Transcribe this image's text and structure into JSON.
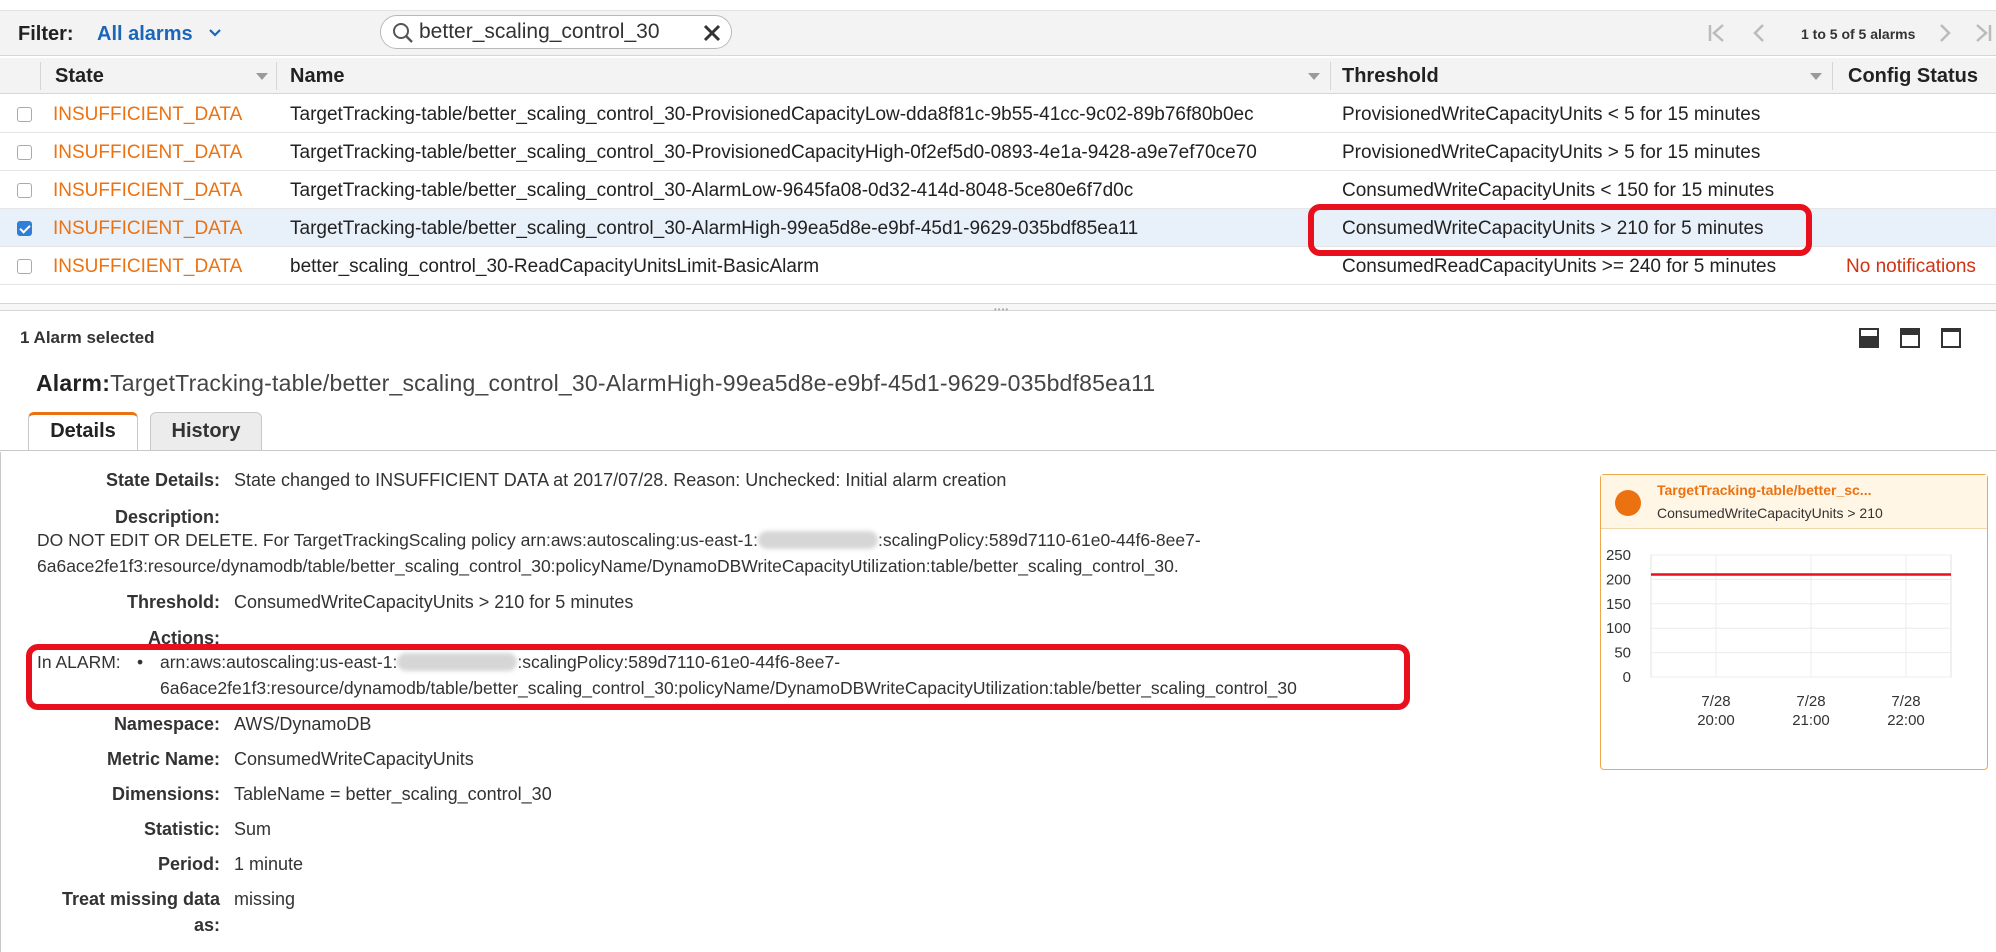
{
  "filter": {
    "label": "Filter:",
    "selected": "All alarms",
    "search_value": "better_scaling_control_30",
    "pager_text": "1 to 5 of 5 alarms"
  },
  "table": {
    "columns": [
      "State",
      "Name",
      "Threshold",
      "Config Status"
    ],
    "rows": [
      {
        "checked": false,
        "state": "INSUFFICIENT_DATA",
        "name": "TargetTracking-table/better_scaling_control_30-ProvisionedCapacityLow-dda8f81c-9b55-41cc-9c02-89b76f80b0ec",
        "threshold": "ProvisionedWriteCapacityUnits < 5 for 15 minutes",
        "config": ""
      },
      {
        "checked": false,
        "state": "INSUFFICIENT_DATA",
        "name": "TargetTracking-table/better_scaling_control_30-ProvisionedCapacityHigh-0f2ef5d0-0893-4e1a-9428-a9e7ef70ce70",
        "threshold": "ProvisionedWriteCapacityUnits > 5 for 15 minutes",
        "config": ""
      },
      {
        "checked": false,
        "state": "INSUFFICIENT_DATA",
        "name": "TargetTracking-table/better_scaling_control_30-AlarmLow-9645fa08-0d32-414d-8048-5ce80e6f7d0c",
        "threshold": "ConsumedWriteCapacityUnits < 150 for 15 minutes",
        "config": ""
      },
      {
        "checked": true,
        "state": "INSUFFICIENT_DATA",
        "name": "TargetTracking-table/better_scaling_control_30-AlarmHigh-99ea5d8e-e9bf-45d1-9629-035bdf85ea11",
        "threshold": "ConsumedWriteCapacityUnits > 210 for 5 minutes",
        "config": ""
      },
      {
        "checked": false,
        "state": "INSUFFICIENT_DATA",
        "name": "better_scaling_control_30-ReadCapacityUnitsLimit-BasicAlarm",
        "threshold": "ConsumedReadCapacityUnits >= 240 for 5 minutes",
        "config": "No notifications"
      }
    ]
  },
  "selection": {
    "count_text": "1 Alarm selected"
  },
  "alarm": {
    "prefix": "Alarm:",
    "name": "TargetTracking-table/better_scaling_control_30-AlarmHigh-99ea5d8e-e9bf-45d1-9629-035bdf85ea11"
  },
  "tabs": [
    "Details",
    "History"
  ],
  "details": {
    "state_details_label": "State Details:",
    "state_details": "State changed to INSUFFICIENT DATA at 2017/07/28. Reason: Unchecked: Initial alarm creation",
    "description_label": "Description:",
    "description_line1_a": "DO NOT EDIT OR DELETE. For TargetTrackingScaling policy arn:aws:autoscaling:us-east-1:",
    "description_line1_b": ":scalingPolicy:589d7110-61e0-44f6-8ee7-",
    "description_line2": "6a6ace2fe1f3:resource/dynamodb/table/better_scaling_control_30:policyName/DynamoDBWriteCapacityUtilization:table/better_scaling_control_30.",
    "threshold_label": "Threshold:",
    "threshold": "ConsumedWriteCapacityUnits > 210 for 5 minutes",
    "actions_label": "Actions:",
    "actions_state": "In ALARM:",
    "actions_bullet": "•",
    "actions_line1_a": "arn:aws:autoscaling:us-east-1:",
    "actions_line1_b": ":scalingPolicy:589d7110-61e0-44f6-8ee7-",
    "actions_line2": "6a6ace2fe1f3:resource/dynamodb/table/better_scaling_control_30:policyName/DynamoDBWriteCapacityUtilization:table/better_scaling_control_30",
    "namespace_label": "Namespace:",
    "namespace": "AWS/DynamoDB",
    "metric_label": "Metric Name:",
    "metric": "ConsumedWriteCapacityUnits",
    "dimensions_label": "Dimensions:",
    "dimensions": "TableName = better_scaling_control_30",
    "statistic_label": "Statistic:",
    "statistic": "Sum",
    "period_label": "Period:",
    "period": "1 minute",
    "missing_label_1": "Treat missing data",
    "missing_label_2": "as:",
    "missing": "missing"
  },
  "mini_chart": {
    "title": "TargetTracking-table/better_sc...",
    "subtitle": "ConsumedWriteCapacityUnits > 210",
    "accent": "#ec7211",
    "threshold_color": "#e8101d"
  },
  "chart_data": {
    "type": "line",
    "title": "TargetTracking-table/better_sc...",
    "subtitle": "ConsumedWriteCapacityUnits > 210",
    "yticks": [
      250,
      200,
      150,
      100,
      50,
      0
    ],
    "ylim": [
      0,
      250
    ],
    "xticks": [
      {
        "date": "7/28",
        "time": "20:00"
      },
      {
        "date": "7/28",
        "time": "21:00"
      },
      {
        "date": "7/28",
        "time": "22:00"
      }
    ],
    "series": [
      {
        "values": [
          210,
          210
        ]
      }
    ],
    "grid": true
  },
  "colors": {
    "state": "#ec7211",
    "link": "#1a66b8",
    "warning": "#d13212",
    "highlight": "#e8101d"
  }
}
